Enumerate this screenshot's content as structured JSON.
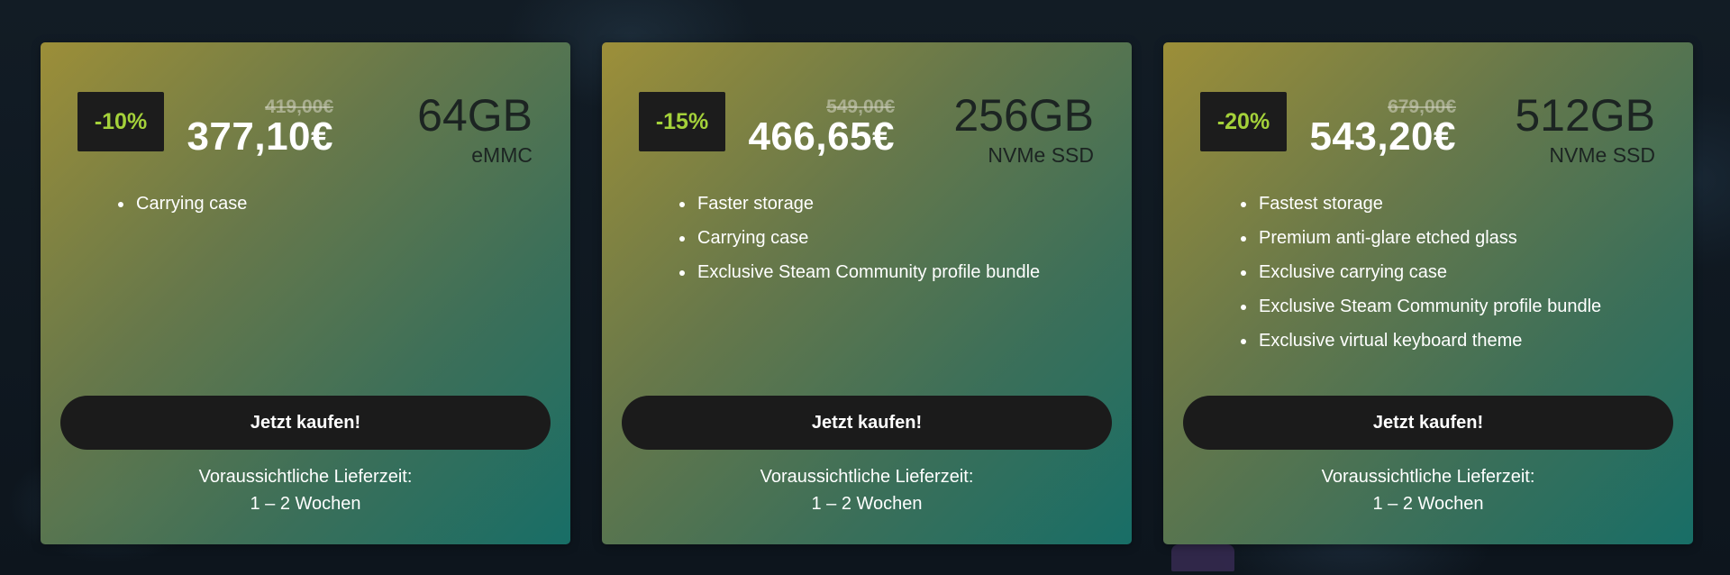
{
  "cards": [
    {
      "discount": "-10%",
      "original_price": "419,00€",
      "price": "377,10€",
      "storage_size": "64GB",
      "storage_type": "eMMC",
      "features": [
        "Carrying case"
      ],
      "button_label": "Jetzt kaufen!",
      "delivery_label": "Voraussichtliche Lieferzeit:",
      "delivery_time": "1 – 2 Wochen"
    },
    {
      "discount": "-15%",
      "original_price": "549,00€",
      "price": "466,65€",
      "storage_size": "256GB",
      "storage_type": "NVMe SSD",
      "features": [
        "Faster storage",
        "Carrying case",
        "Exclusive Steam Community profile bundle"
      ],
      "button_label": "Jetzt kaufen!",
      "delivery_label": "Voraussichtliche Lieferzeit:",
      "delivery_time": "1 – 2 Wochen"
    },
    {
      "discount": "-20%",
      "original_price": "679,00€",
      "price": "543,20€",
      "storage_size": "512GB",
      "storage_type": "NVMe SSD",
      "features": [
        "Fastest storage",
        "Premium anti-glare etched glass",
        "Exclusive carrying case",
        "Exclusive Steam Community profile bundle",
        "Exclusive virtual keyboard theme"
      ],
      "button_label": "Jetzt kaufen!",
      "delivery_label": "Voraussichtliche Lieferzeit:",
      "delivery_time": "1 – 2 Wochen"
    }
  ],
  "colors": {
    "discount_text": "#a4d13a",
    "badge_bg": "#1c1c1c",
    "button_bg": "#1b1b1b",
    "card_gradient_start": "#a8983a",
    "card_gradient_end": "#187068"
  }
}
